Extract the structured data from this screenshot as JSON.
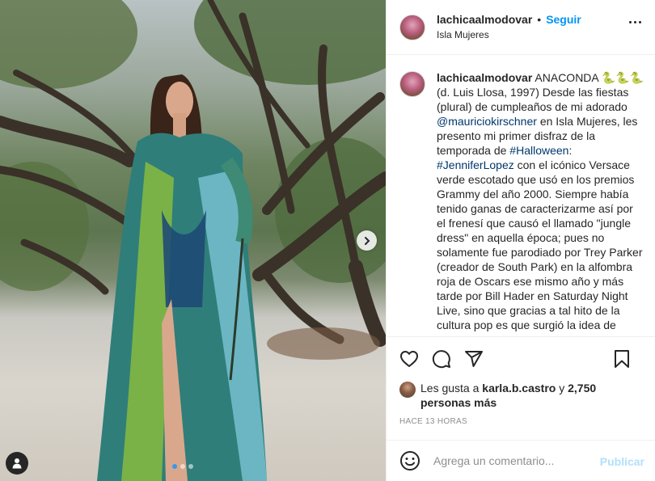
{
  "header": {
    "username": "lachicaalmodovar",
    "separator": "•",
    "follow_label": "Seguir",
    "location": "Isla Mujeres"
  },
  "caption": {
    "username": "lachicaalmodovar",
    "title": "ANACONDA",
    "emoji": "🐍🐍🐍",
    "text_1": "(d. Luis Llosa, 1997) Desde las fiestas (plural) de cumpleaños de mi adorado",
    "mention": "@mauriciokirschner",
    "text_2": "en Isla Mujeres, les presento mi primer disfraz de la temporada de",
    "hashtag_1": "#Halloween",
    "text_3": ":",
    "hashtag_2": "#JenniferLopez",
    "text_4": "con el icónico Versace verde escotado que usó en los premios Grammy del año 2000. Siempre había tenido ganas de caracterizarme así por el frenesí que causó el llamado \"jungle dress\" en aquella época; pues no solamente fue parodiado por Trey Parker (creador de South Park) en la alfombra roja de Oscars ese mismo año y más tarde por Bill Hader en Saturday Night Live, sino que gracias a tal hito de la cultura pop es que surgió la idea de"
  },
  "likes": {
    "prefix": "Les gusta a",
    "user": "karla.b.castro",
    "conj": "y",
    "count": "2,750 personas más"
  },
  "timestamp": "HACE 13 HORAS",
  "comment": {
    "placeholder": "Agrega un comentario...",
    "publish_label": "Publicar"
  },
  "carousel": {
    "slides": 3,
    "current": 1
  },
  "colors": {
    "accent": "#0095f6",
    "link": "#00376b",
    "publish_disabled": "#b2dffc",
    "muted": "#8e8e8e"
  },
  "icons": [
    "more-icon",
    "next-arrow-icon",
    "tag-user-icon",
    "heart-icon",
    "comment-icon",
    "share-icon",
    "save-icon",
    "emoji-icon"
  ]
}
